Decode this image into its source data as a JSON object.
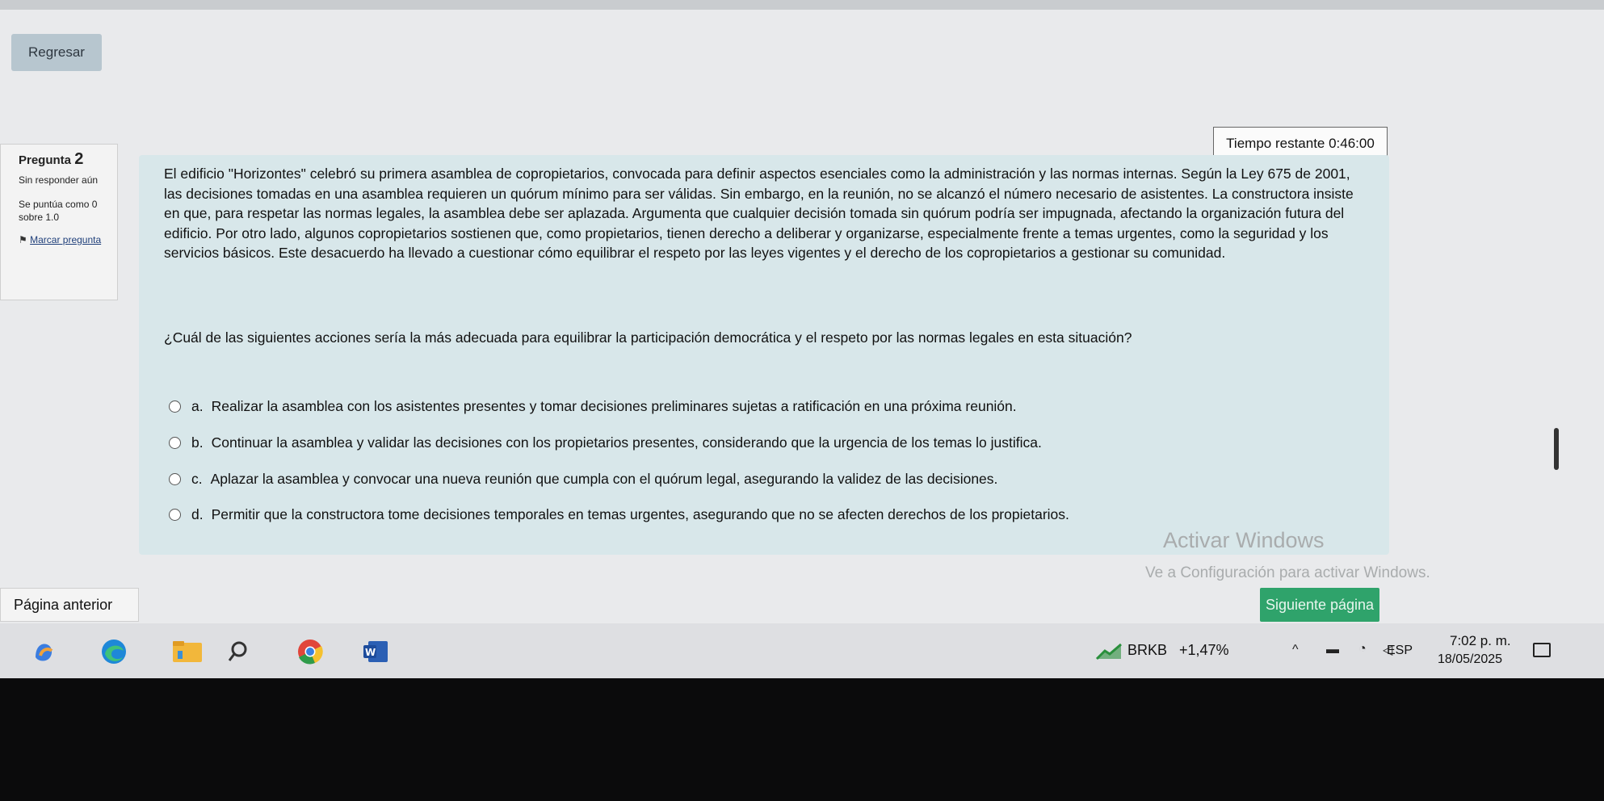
{
  "nav": {
    "back_label": "Regresar"
  },
  "timer": {
    "label": "Tiempo restante 0:46:00"
  },
  "question_info": {
    "title": "Pregunta",
    "number": "2",
    "status": "Sin responder aún",
    "score": "Se puntúa como 0 sobre 1.0",
    "flag_label": "Marcar pregunta"
  },
  "question": {
    "text": "El edificio \"Horizontes\" celebró su primera asamblea de copropietarios, convocada para definir aspectos esenciales como la administración y las normas internas. Según la Ley 675 de 2001, las decisiones tomadas en una asamblea requieren un quórum mínimo para ser válidas. Sin embargo, en la reunión, no se alcanzó el número necesario de asistentes. La constructora insiste en que, para respetar las normas legales, la asamblea debe ser aplazada. Argumenta que cualquier decisión tomada sin quórum podría ser impugnada, afectando la organización futura del edificio. Por otro lado, algunos copropietarios sostienen que, como propietarios, tienen derecho a deliberar y organizarse, especialmente frente a temas urgentes, como la seguridad y los servicios básicos. Este desacuerdo ha llevado a cuestionar cómo equilibrar el respeto por las leyes vigentes y el derecho de los copropietarios a gestionar su comunidad.",
    "prompt": "¿Cuál de las siguientes acciones sería la más adecuada para equilibrar la participación democrática y el respeto por las normas legales en esta situación?",
    "options": [
      {
        "letter": "a.",
        "text": "Realizar la asamblea con los asistentes presentes y tomar decisiones preliminares sujetas a ratificación en una próxima reunión."
      },
      {
        "letter": "b.",
        "text": "Continuar la asamblea y validar las decisiones con los propietarios presentes, considerando que la urgencia de los temas lo justifica."
      },
      {
        "letter": "c.",
        "text": "Aplazar la asamblea y convocar una nueva reunión que cumpla con el quórum legal, asegurando la validez de las decisiones."
      },
      {
        "letter": "d.",
        "text": "Permitir que la constructora tome decisiones temporales en temas urgentes, asegurando que no se afecten derechos de los propietarios."
      }
    ]
  },
  "watermark": {
    "title": "Activar Windows",
    "subtitle": "Ve a Configuración para activar Windows."
  },
  "footer": {
    "prev_label": "Página anterior",
    "next_label": "Siguiente página"
  },
  "taskbar": {
    "apps": [
      "copilot-icon",
      "edge-icon",
      "file-explorer-icon",
      "search-icon",
      "chrome-icon",
      "word-icon"
    ],
    "stock_name": "BRKB",
    "stock_change": "+1,47%",
    "language": "ESP",
    "time": "7:02 p. m.",
    "date": "18/05/2025"
  },
  "colors": {
    "question_bg": "#d8e7ea",
    "next_button": "#2fa36b",
    "back_button": "#b7c6cf"
  }
}
